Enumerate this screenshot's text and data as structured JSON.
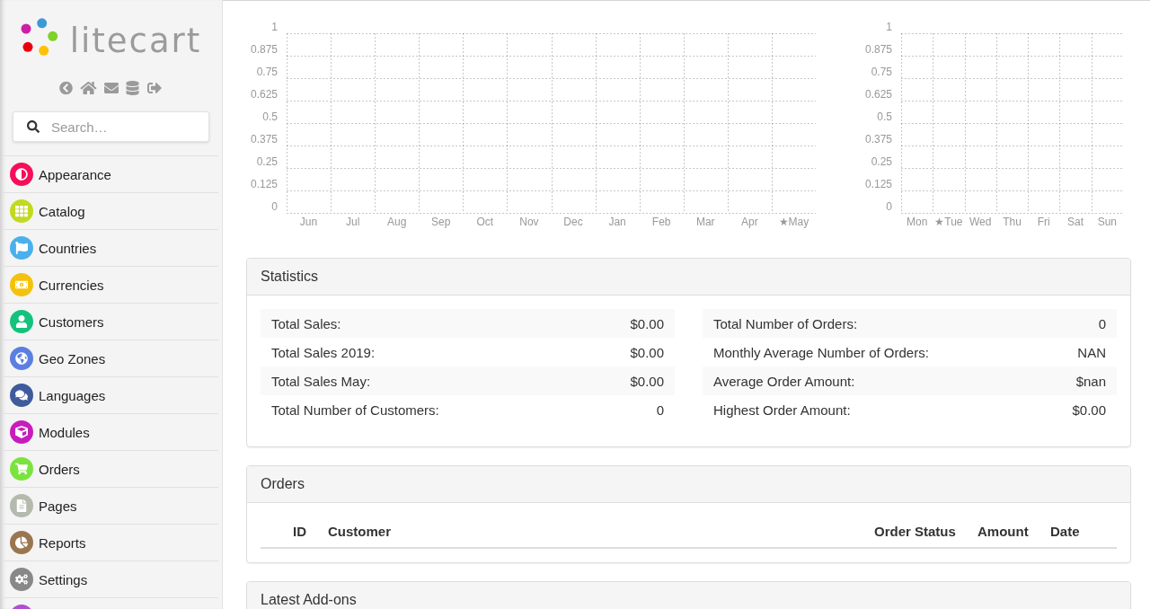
{
  "logo": {
    "text": "litecart"
  },
  "search": {
    "placeholder": "Search…"
  },
  "sidebar": {
    "items": [
      {
        "label": "Appearance",
        "color": "#f50f5a"
      },
      {
        "label": "Catalog",
        "color": "#c2d920"
      },
      {
        "label": "Countries",
        "color": "#4ab0ec"
      },
      {
        "label": "Currencies",
        "color": "#f4c20d"
      },
      {
        "label": "Customers",
        "color": "#13c27c"
      },
      {
        "label": "Geo Zones",
        "color": "#5b7fe0"
      },
      {
        "label": "Languages",
        "color": "#3f5b9c"
      },
      {
        "label": "Modules",
        "color": "#c81cbd"
      },
      {
        "label": "Orders",
        "color": "#7ae33e"
      },
      {
        "label": "Pages",
        "color": "#b4bbad"
      },
      {
        "label": "Reports",
        "color": "#9a7650"
      },
      {
        "label": "Settings",
        "color": "#888888"
      },
      {
        "color": "#b24fd0"
      }
    ]
  },
  "charts": [
    {
      "chart_data": {
        "type": "bar",
        "grid": true,
        "categories": [
          "Jun",
          "Jul",
          "Aug",
          "Sep",
          "Oct",
          "Nov",
          "Dec",
          "Jan",
          "Feb",
          "Mar",
          "Apr",
          "★May"
        ],
        "ylim": [
          0,
          1
        ],
        "yticks": [
          0,
          0.125,
          0.25,
          0.375,
          0.5,
          0.625,
          0.75,
          0.875,
          1
        ]
      }
    },
    {
      "chart_data": {
        "type": "bar",
        "grid": true,
        "categories": [
          "Mon",
          "★Tue",
          "Wed",
          "Thu",
          "Fri",
          "Sat",
          "Sun"
        ],
        "ylim": [
          0,
          1
        ],
        "yticks": [
          0,
          0.125,
          0.25,
          0.375,
          0.5,
          0.625,
          0.75,
          0.875,
          1
        ]
      }
    }
  ],
  "statistics": {
    "title": "Statistics",
    "columns": [
      [
        {
          "label": "Total Sales:",
          "value": "$0.00"
        },
        {
          "label": "Total Sales 2019:",
          "value": "$0.00"
        },
        {
          "label": "Total Sales May:",
          "value": "$0.00"
        },
        {
          "label": "Total Number of Customers:",
          "value": "0"
        }
      ],
      [
        {
          "label": "Total Number of Orders:",
          "value": "0"
        },
        {
          "label": "Monthly Average Number of Orders:",
          "value": "NAN"
        },
        {
          "label": "Average Order Amount:",
          "value": "$nan"
        },
        {
          "label": "Highest Order Amount:",
          "value": "$0.00"
        }
      ]
    ]
  },
  "orders": {
    "title": "Orders",
    "table": {
      "columns": [
        "ID",
        "Customer",
        "Order Status",
        "Amount",
        "Date"
      ]
    }
  },
  "latest_addons": {
    "title": "Latest Add-ons"
  }
}
